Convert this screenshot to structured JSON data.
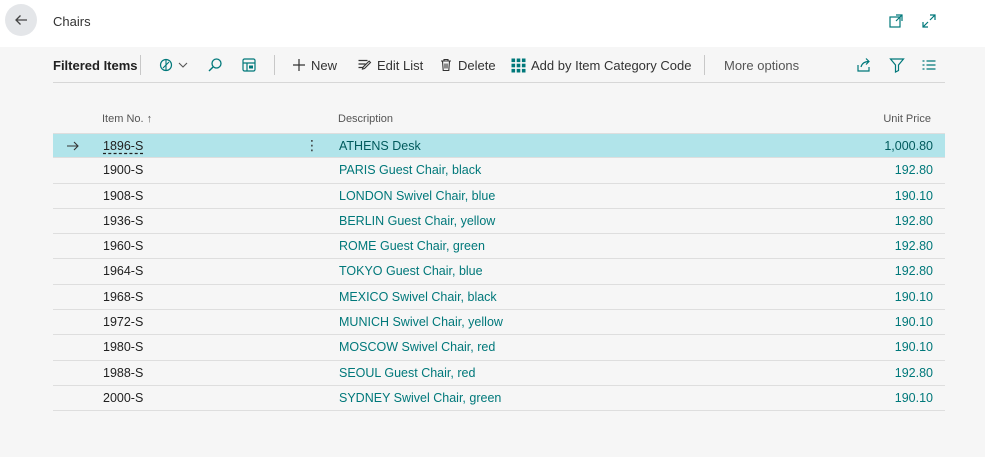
{
  "page": {
    "title": "Chairs"
  },
  "actions": {
    "filtered_label": "Filtered Items",
    "new_label": "New",
    "edit_list_label": "Edit List",
    "delete_label": "Delete",
    "add_by_category_label": "Add by Item Category Code",
    "more_options_label": "More options"
  },
  "icons": {
    "back": "back-arrow-icon",
    "popout": "popout-icon",
    "expand": "expand-icon",
    "view_switch": "view-switch-icon",
    "search": "search-icon",
    "analysis": "analysis-mode-icon",
    "share": "share-icon",
    "filter": "filter-icon",
    "list": "list-view-icon"
  },
  "colors": {
    "accent": "#00787a",
    "selected_row": "#b1e4ea"
  },
  "table": {
    "columns": {
      "item_no": "Item No.",
      "sort_indicator": "↑",
      "description": "Description",
      "unit_price": "Unit Price"
    },
    "rows": [
      {
        "item_no": "1896-S",
        "description": "ATHENS Desk",
        "unit_price": "1,000.80",
        "selected": true
      },
      {
        "item_no": "1900-S",
        "description": "PARIS Guest Chair, black",
        "unit_price": "192.80"
      },
      {
        "item_no": "1908-S",
        "description": "LONDON Swivel Chair, blue",
        "unit_price": "190.10"
      },
      {
        "item_no": "1936-S",
        "description": "BERLIN Guest Chair, yellow",
        "unit_price": "192.80"
      },
      {
        "item_no": "1960-S",
        "description": "ROME Guest Chair, green",
        "unit_price": "192.80"
      },
      {
        "item_no": "1964-S",
        "description": "TOKYO Guest Chair, blue",
        "unit_price": "192.80"
      },
      {
        "item_no": "1968-S",
        "description": "MEXICO Swivel Chair, black",
        "unit_price": "190.10"
      },
      {
        "item_no": "1972-S",
        "description": "MUNICH Swivel Chair, yellow",
        "unit_price": "190.10"
      },
      {
        "item_no": "1980-S",
        "description": "MOSCOW Swivel Chair, red",
        "unit_price": "190.10"
      },
      {
        "item_no": "1988-S",
        "description": "SEOUL Guest Chair, red",
        "unit_price": "192.80"
      },
      {
        "item_no": "2000-S",
        "description": "SYDNEY Swivel Chair, green",
        "unit_price": "190.10"
      }
    ]
  }
}
